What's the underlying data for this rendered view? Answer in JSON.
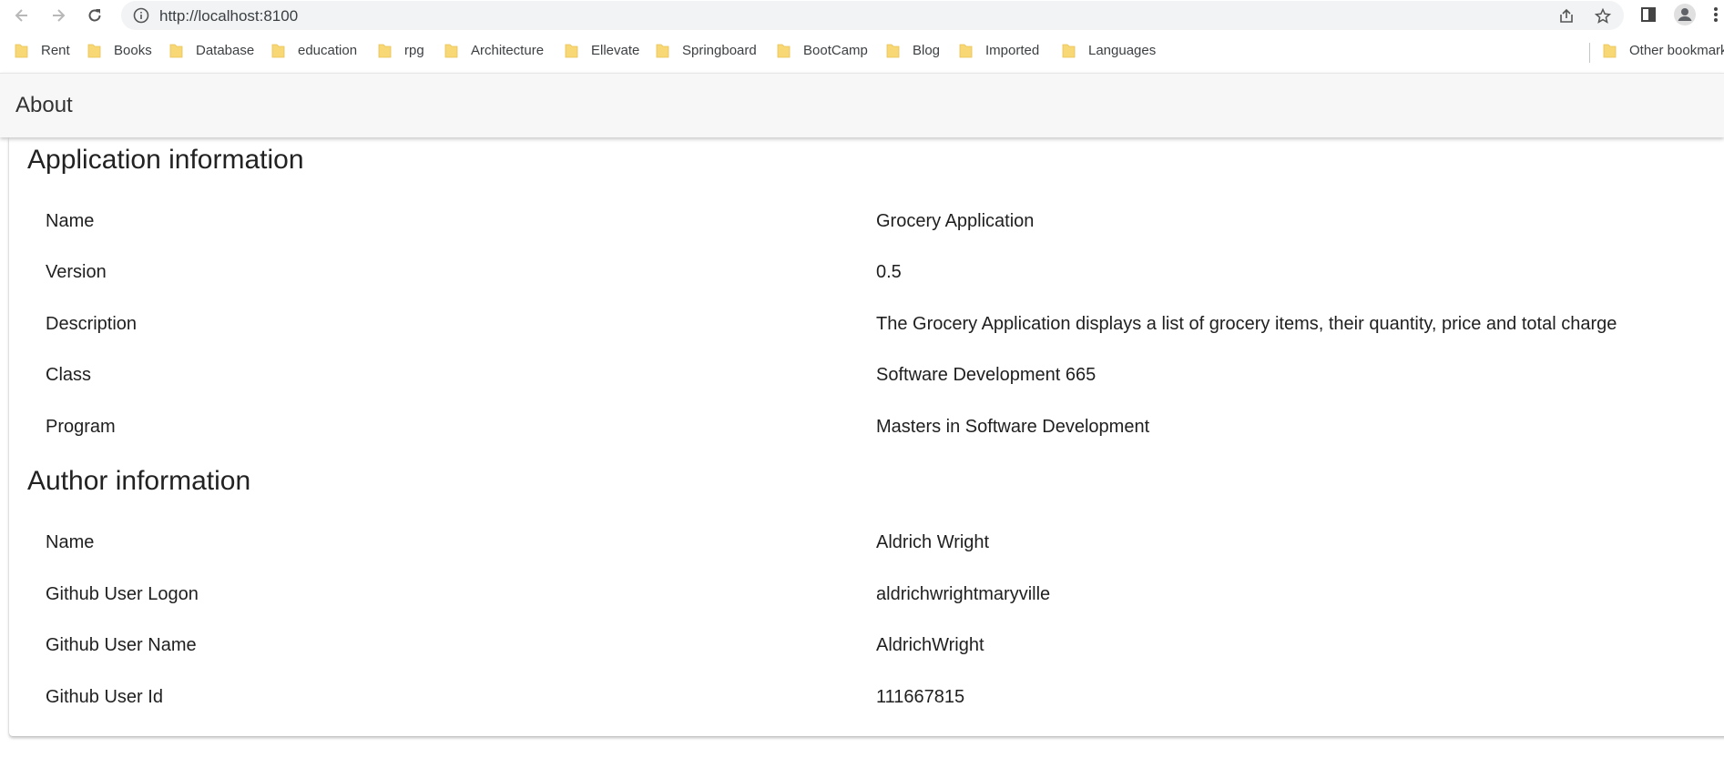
{
  "browser": {
    "url": "http://localhost:8100",
    "bookmarks": [
      "Rent",
      "Books",
      "Database",
      "education",
      "rpg",
      "Architecture",
      "Ellevate",
      "Springboard",
      "BootCamp",
      "Blog",
      "Imported",
      "Languages"
    ],
    "other_bookmarks": "Other bookmarks"
  },
  "app": {
    "title": "About"
  },
  "application_info": {
    "heading": "Application information",
    "rows": [
      {
        "label": "Name",
        "value": "Grocery Application"
      },
      {
        "label": "Version",
        "value": "0.5"
      },
      {
        "label": "Description",
        "value": "The Grocery Application displays a list of grocery items, their quantity, price and total charge"
      },
      {
        "label": "Class",
        "value": "Software Development 665"
      },
      {
        "label": "Program",
        "value": "Masters in Software Development"
      }
    ]
  },
  "author_info": {
    "heading": "Author information",
    "rows": [
      {
        "label": "Name",
        "value": "Aldrich Wright"
      },
      {
        "label": "Github User Logon",
        "value": "aldrichwrightmaryville"
      },
      {
        "label": "Github User Name",
        "value": "AldrichWright"
      },
      {
        "label": "Github User Id",
        "value": "111667815"
      }
    ]
  },
  "colors": {
    "folder": "#f8d775",
    "header_bg": "#f7f7f7",
    "omnibox_bg": "#f1f3f4"
  }
}
